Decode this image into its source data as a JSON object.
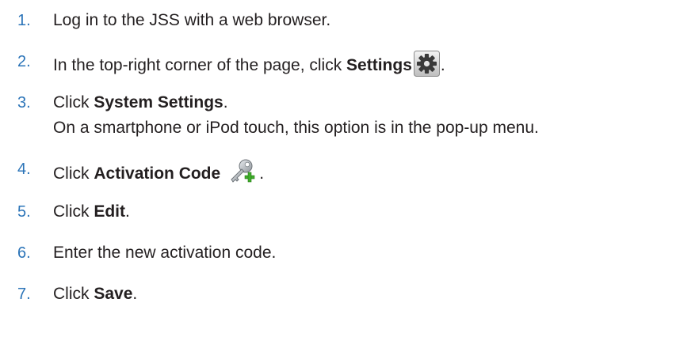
{
  "steps": [
    {
      "num": "1.",
      "before": "Log in to the JSS with a web browser.",
      "bold": "",
      "after": ""
    },
    {
      "num": "2.",
      "before": "In the top-right corner of the page, click ",
      "bold": "Settings",
      "after": ".",
      "icon": "gear-icon"
    },
    {
      "num": "3.",
      "before": "Click ",
      "bold": "System Settings",
      "after": "."
    },
    {
      "num": "4.",
      "before": "Click ",
      "bold": "Activation Code",
      "after": ".",
      "icon": "key-add-icon"
    },
    {
      "num": "5.",
      "before": "Click ",
      "bold": "Edit",
      "after": "."
    },
    {
      "num": "6.",
      "before": "Enter the new activation code.",
      "bold": "",
      "after": ""
    },
    {
      "num": "7.",
      "before": "Click ",
      "bold": "Save",
      "after": "."
    }
  ],
  "step3_note": "On a smartphone or iPod touch, this option is in the pop-up menu.",
  "colors": {
    "number": "#2b74b8",
    "text": "#231f20",
    "background": "#ffffff"
  }
}
